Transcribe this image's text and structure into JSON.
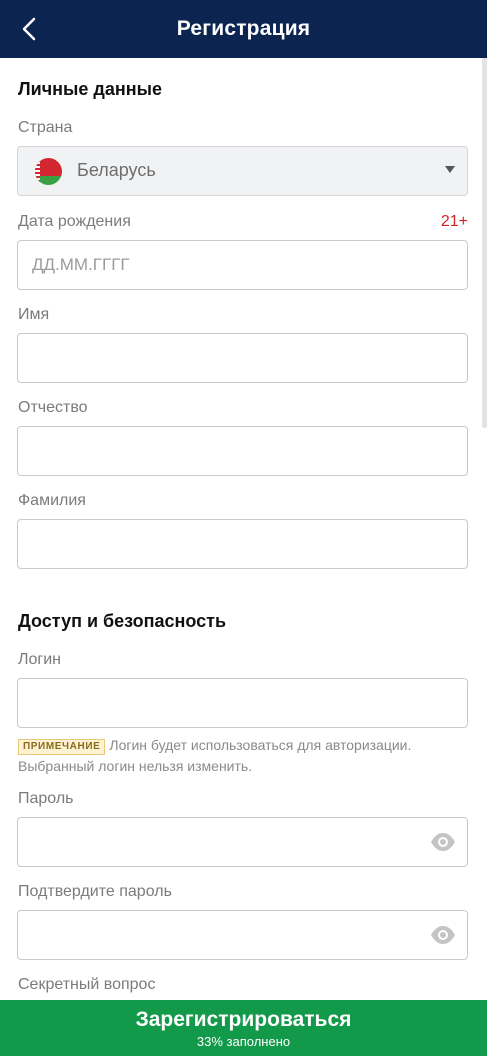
{
  "header": {
    "title": "Регистрация"
  },
  "personal": {
    "section_title": "Личные данные",
    "country_label": "Страна",
    "country_value": "Беларусь",
    "birthdate_label": "Дата рождения",
    "age_badge": "21+",
    "birthdate_placeholder": "ДД.ММ.ГГГГ",
    "first_name_label": "Имя",
    "patronymic_label": "Отчество",
    "last_name_label": "Фамилия"
  },
  "access": {
    "section_title": "Доступ и безопасность",
    "login_label": "Логин",
    "note_badge": "ПРИМЕЧАНИЕ",
    "note_text": "Логин будет использоваться для авторизации. Выбранный логин нельзя изменить.",
    "password_label": "Пароль",
    "confirm_label": "Подтвердите пароль",
    "secret_question_label": "Секретный вопрос"
  },
  "submit": {
    "label": "Зарегистрироваться",
    "progress_text": "33% заполнено",
    "progress_fraction": 0.33
  },
  "colors": {
    "header_bg": "#0b2450",
    "submit_bg": "#13994a",
    "age_badge": "#d2232a"
  },
  "icons": [
    "back-arrow-icon",
    "belarus-flag-icon",
    "dropdown-caret-icon",
    "eye-icon"
  ]
}
